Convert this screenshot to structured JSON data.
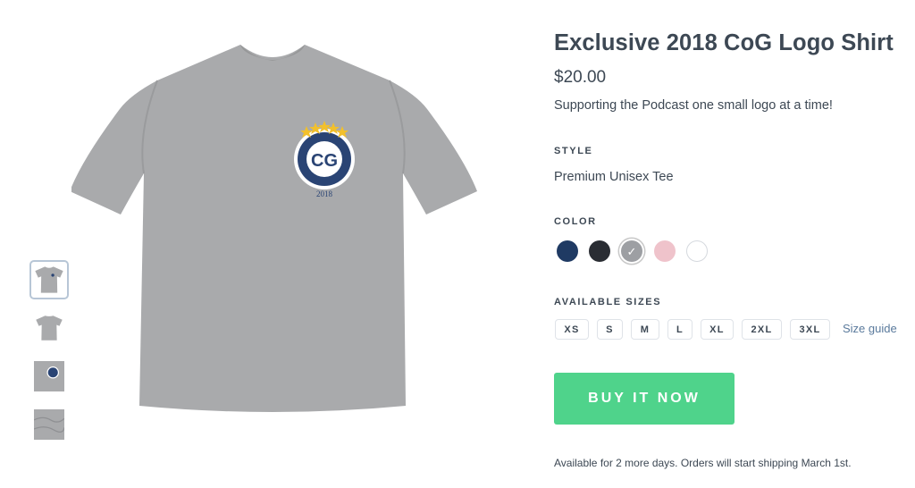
{
  "product": {
    "title": "Exclusive 2018 CoG Logo Shirt",
    "price": "$20.00",
    "description": "Supporting the Podcast one small logo at a time!",
    "logo_year": "2018"
  },
  "style": {
    "label": "STYLE",
    "value": "Premium Unisex Tee"
  },
  "color": {
    "label": "COLOR",
    "swatches": [
      {
        "name": "navy",
        "hex": "#1f3a63",
        "selected": false
      },
      {
        "name": "black",
        "hex": "#2a2d33",
        "selected": false
      },
      {
        "name": "heather-grey",
        "hex": "#9d9fa3",
        "selected": true
      },
      {
        "name": "pink",
        "hex": "#efc3cb",
        "selected": false
      },
      {
        "name": "white",
        "hex": "#ffffff",
        "selected": false
      }
    ]
  },
  "sizes": {
    "label": "AVAILABLE SIZES",
    "options": [
      "XS",
      "S",
      "M",
      "L",
      "XL",
      "2XL",
      "3XL"
    ],
    "guide_label": "Size guide"
  },
  "buy_button": {
    "label": "BUY IT NOW",
    "color": "#4fd38b"
  },
  "availability": "Available for 2 more days. Orders will start shipping March 1st.",
  "thumbnails": [
    {
      "name": "front",
      "active": true
    },
    {
      "name": "back",
      "active": false
    },
    {
      "name": "logo-closeup",
      "active": false
    },
    {
      "name": "fabric-closeup",
      "active": false
    }
  ],
  "colors": {
    "text": "#3d4854",
    "shirt": "#a9aaac",
    "link": "#5a7a9c"
  }
}
